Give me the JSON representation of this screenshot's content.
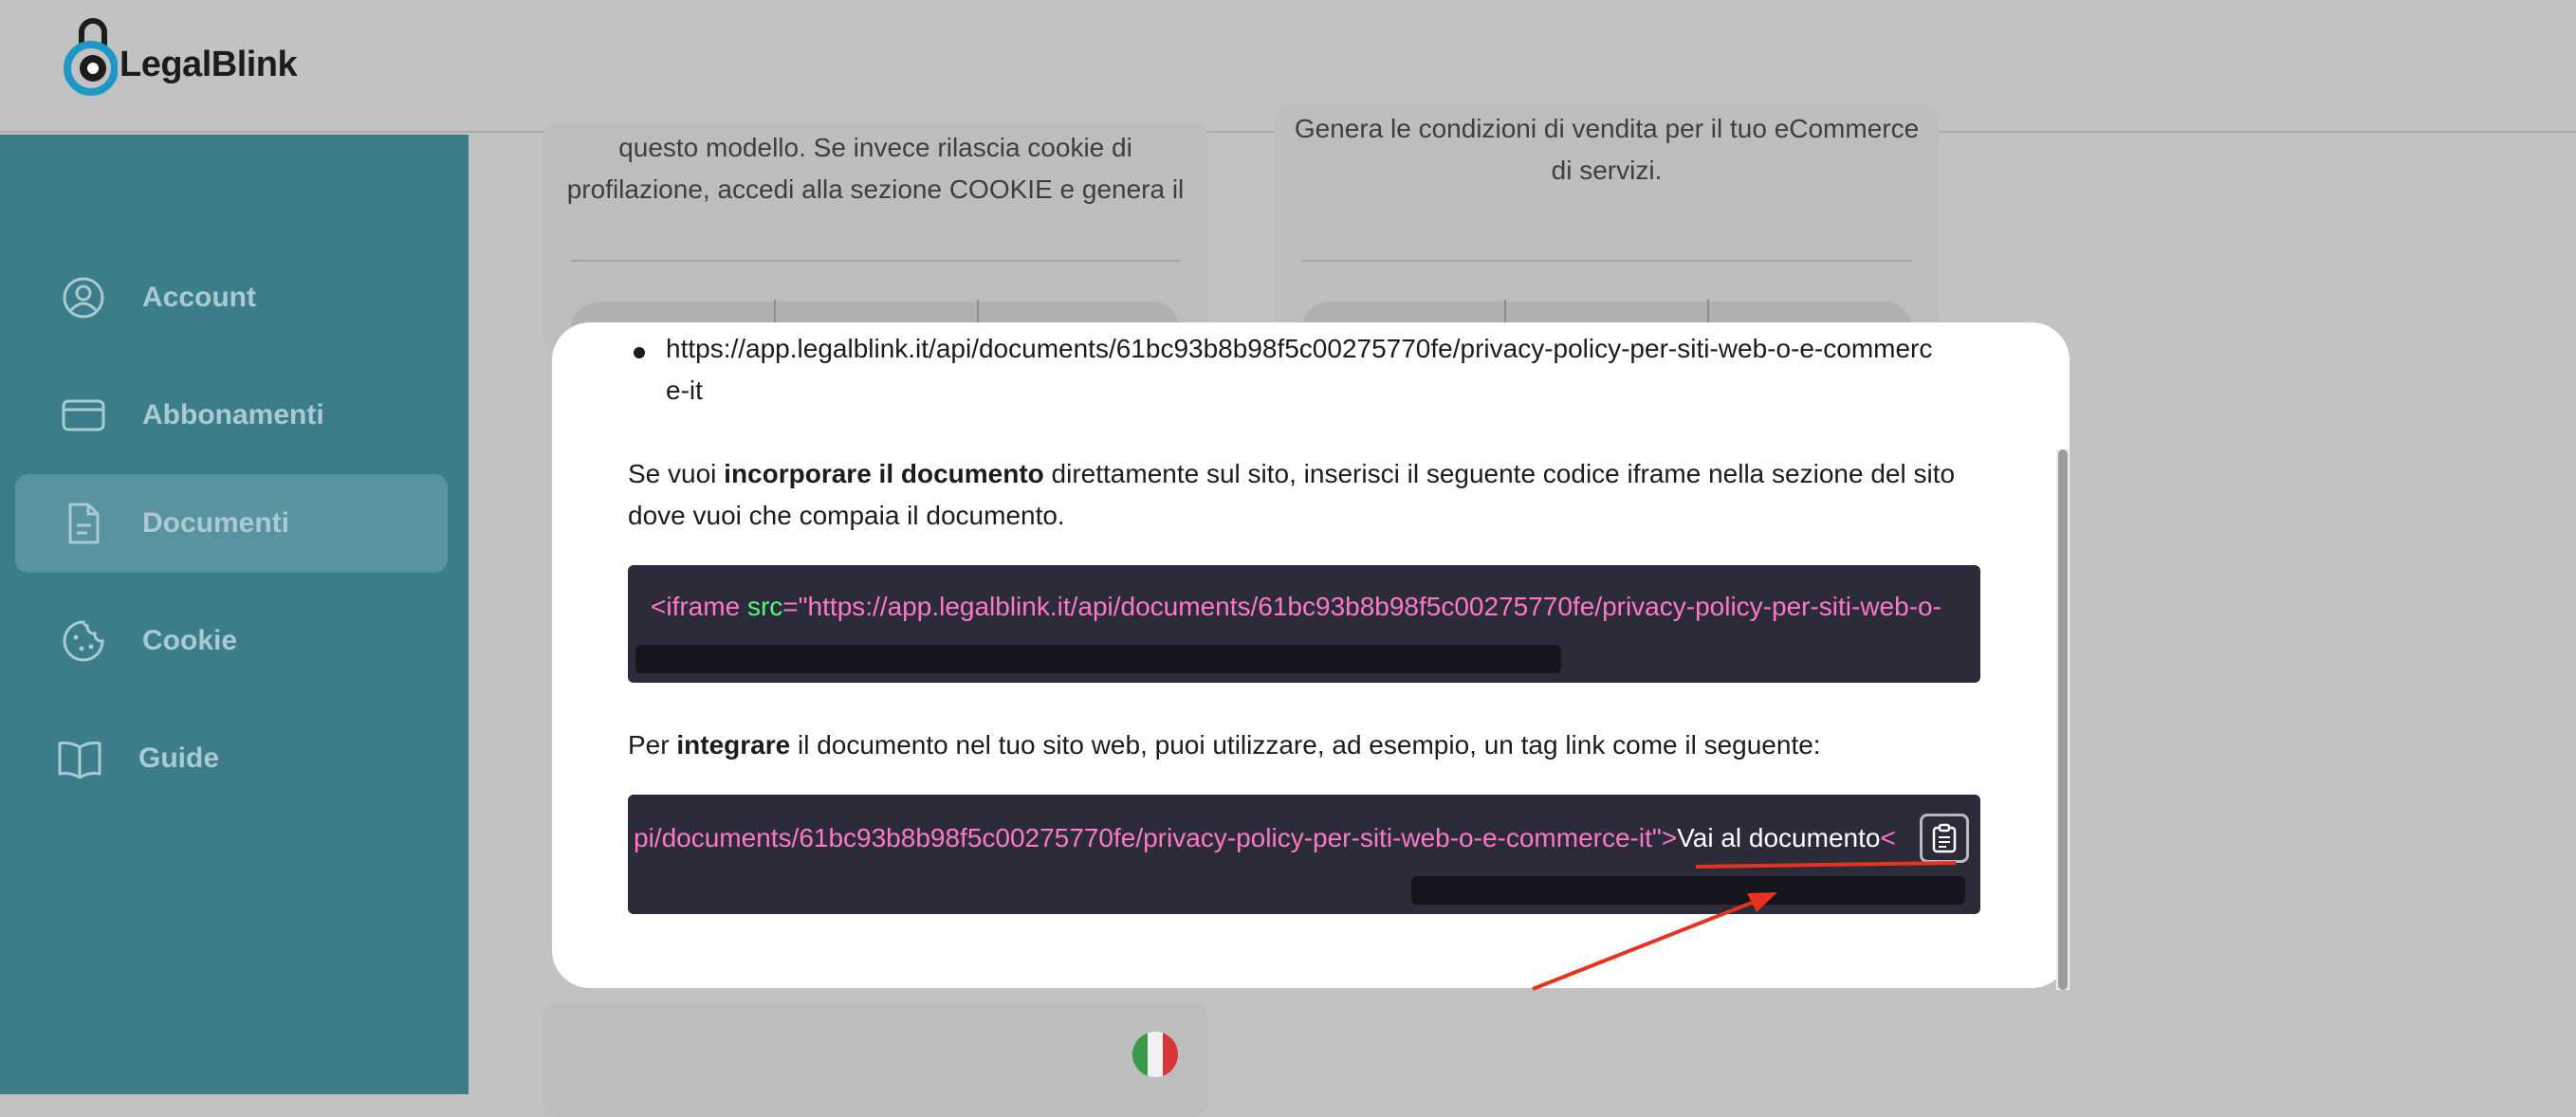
{
  "brand": {
    "name": "LegalBlink"
  },
  "sidebar": {
    "items": [
      {
        "label": "Account",
        "icon": "user-circle-icon",
        "active": false
      },
      {
        "label": "Abbonamenti",
        "icon": "credit-card-icon",
        "active": false
      },
      {
        "label": "Documenti",
        "icon": "document-icon",
        "active": true
      },
      {
        "label": "Cookie",
        "icon": "cookie-icon",
        "active": false
      },
      {
        "label": "Guide",
        "icon": "book-icon",
        "active": false
      }
    ]
  },
  "background_cards": {
    "left_text_line1": "questo modello. Se invece rilascia cookie di",
    "left_text_line2": "profilazione, accedi alla sezione COOKIE e genera il",
    "right_text_line1": "Genera le condizioni di vendita per il tuo eCommerce",
    "right_text_line2": "di servizi."
  },
  "modal": {
    "document_url": "https://app.legalblink.it/api/documents/61bc93b8b98f5c00275770fe/privacy-policy-per-siti-web-o-e-commerce-it",
    "embed_intro": {
      "before": "Se vuoi ",
      "bold": "incorporare il documento",
      "after": " direttamente sul sito, inserisci il seguente codice iframe nella sezione del sito dove vuoi che compaia il documento."
    },
    "iframe_code": {
      "tag_open": "<iframe ",
      "attr": "src",
      "value": "=\"https://app.legalblink.it/api/documents/61bc93b8b98f5c00275770fe/privacy-policy-per-siti-web-o-"
    },
    "link_intro": {
      "before": "Per ",
      "bold": "integrare",
      "after": " il documento nel tuo sito web, puoi utilizzare, ad esempio, un tag link come il seguente:"
    },
    "link_code": {
      "href_tail": "pi/documents/61bc93b8b98f5c00275770fe/privacy-policy-per-siti-web-o-e-commerce-it\">",
      "link_text": "Vai al documento",
      "close": "<"
    },
    "copy_button": {
      "icon": "clipboard-icon"
    }
  },
  "annotation": {
    "color": "#e8321e"
  },
  "colors": {
    "sidebar": "#3c7d8a",
    "code_bg": "#2b2b39",
    "code_pink": "#ff79c6",
    "code_green": "#50fa7b"
  }
}
